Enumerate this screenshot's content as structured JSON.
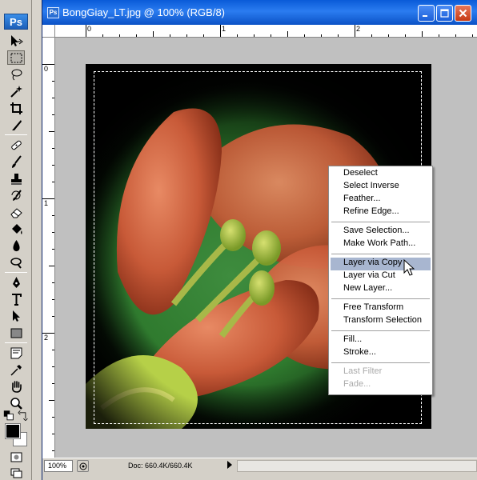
{
  "toolbox": {
    "logo": "Ps",
    "tools": [
      "move-tool",
      "marquee-tool",
      "lasso-tool",
      "magic-wand-tool",
      "crop-tool",
      "slice-tool",
      "healing-brush-tool",
      "brush-tool",
      "clone-stamp-tool",
      "history-brush-tool",
      "eraser-tool",
      "paint-bucket-tool",
      "blur-tool",
      "dodge-tool",
      "pen-tool",
      "type-tool",
      "path-selection-tool",
      "rectangle-tool",
      "notes-tool",
      "eyedropper-tool",
      "hand-tool",
      "zoom-tool"
    ],
    "active_tool": "marquee-tool",
    "foreground_color": "#000000",
    "background_color": "#ffffff"
  },
  "window": {
    "title": "BongGiay_LT.jpg @ 100% (RGB/8)",
    "doc_icon": "Ps",
    "buttons": [
      "minimize-icon",
      "maximize-icon",
      "close-icon"
    ]
  },
  "rulers": {
    "horizontal": [
      "0",
      "1",
      "2"
    ],
    "vertical": [
      "0",
      "1",
      "2"
    ]
  },
  "status": {
    "zoom": "100%",
    "doc_info": "Doc: 660.4K/660.4K"
  },
  "context_menu": {
    "groups": [
      [
        {
          "label": "Deselect"
        },
        {
          "label": "Select Inverse"
        },
        {
          "label": "Feather..."
        },
        {
          "label": "Refine Edge..."
        }
      ],
      [
        {
          "label": "Save Selection..."
        },
        {
          "label": "Make Work Path..."
        }
      ],
      [
        {
          "label": "Layer via Copy",
          "highlighted": true
        },
        {
          "label": "Layer via Cut"
        },
        {
          "label": "New Layer..."
        }
      ],
      [
        {
          "label": "Free Transform"
        },
        {
          "label": "Transform Selection"
        }
      ],
      [
        {
          "label": "Fill..."
        },
        {
          "label": "Stroke..."
        }
      ],
      [
        {
          "label": "Last Filter",
          "disabled": true
        },
        {
          "label": "Fade...",
          "disabled": true
        }
      ]
    ]
  },
  "colors": {
    "title_bar": "#0a5bd8",
    "menu_highlight": "#a8b6d0",
    "canvas_background": "#c0c0c0"
  }
}
